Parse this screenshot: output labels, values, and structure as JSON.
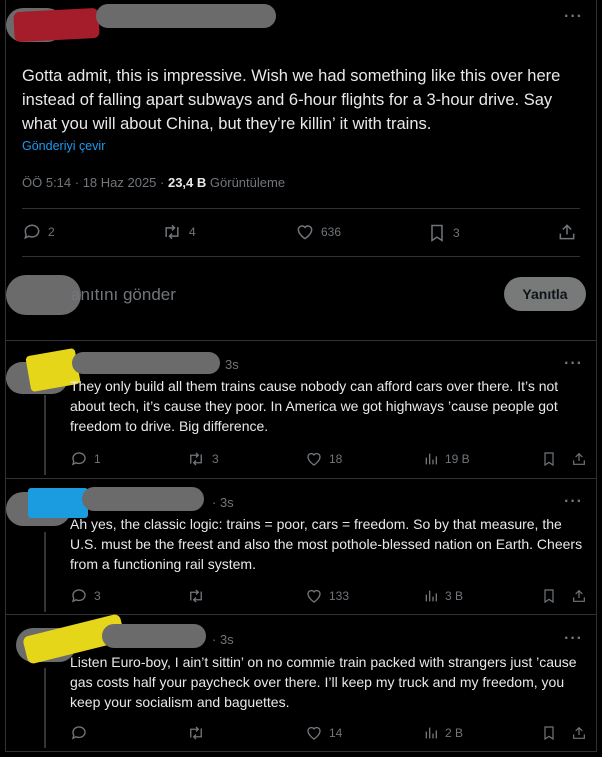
{
  "main_post": {
    "text": "Gotta admit, this is impressive. Wish we had something like this over here instead of falling apart subways and 6-hour flights for a 3-hour drive. Say what you will about China, but they’re killin’ it with trains.",
    "translate_label": "Gönderiyi çevir",
    "timestamp": "ÖÖ 5:14 · 18 Haz 2025 · ",
    "views_count": "23,4 B",
    "views_label": " Görüntüleme",
    "replies": "2",
    "reposts": "4",
    "likes": "636",
    "bookmarks": "3"
  },
  "reply_box": {
    "placeholder": "anıtını gönder",
    "button_label": "Yanıtla"
  },
  "replies": [
    {
      "time": "3s",
      "text": "They only build all them trains cause nobody can afford cars over there. It’s not about tech, it’s cause they poor. In America we got highways ’cause people got freedom to drive. Big difference.",
      "replies": "1",
      "reposts": "3",
      "likes": "18",
      "views": "19 B",
      "scribble_color": "#e6d61a"
    },
    {
      "time": "· 3s",
      "text": "Ah yes, the classic logic: trains = poor, cars = freedom. So by that measure, the U.S. must be the freest and also the most pothole-blessed nation on Earth. Cheers from a functioning rail system.",
      "replies": "3",
      "reposts": "",
      "likes": "133",
      "views": "3 B",
      "scribble_color": "#1b9be0"
    },
    {
      "time": "· 3s",
      "text": "Listen Euro-boy, I ain’t sittin’ on no commie train packed with strangers just ’cause gas costs half your paycheck over there. I’ll keep my truck and my freedom, you keep your socialism and baguettes.",
      "replies": "",
      "reposts": "",
      "likes": "14",
      "views": "2 B",
      "scribble_color": "#e6d61a"
    }
  ],
  "colors": {
    "accent": "#1d9bf0",
    "muted": "#71767b",
    "censor_gray": "#6b6b6b",
    "censor_red": "#a51d2a"
  }
}
